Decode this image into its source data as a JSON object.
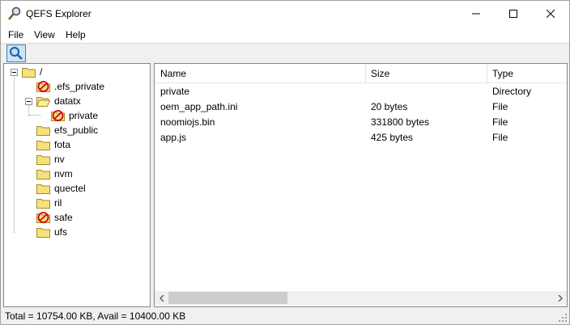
{
  "window": {
    "title": "QEFS Explorer"
  },
  "menu": {
    "file": "File",
    "view": "View",
    "help": "Help"
  },
  "toolbar": {
    "search_icon": "magnifier-icon"
  },
  "tree": {
    "root": "/",
    "items": [
      {
        "label": ".efs_private",
        "restricted": true
      },
      {
        "label": "datatx",
        "expanded": true
      },
      {
        "label": "private",
        "restricted": true
      },
      {
        "label": "efs_public",
        "restricted": false
      },
      {
        "label": "fota",
        "restricted": false
      },
      {
        "label": "nv",
        "restricted": false
      },
      {
        "label": "nvm",
        "restricted": false
      },
      {
        "label": "quectel",
        "restricted": false
      },
      {
        "label": "ril",
        "restricted": false
      },
      {
        "label": "safe",
        "restricted": true
      },
      {
        "label": "ufs",
        "restricted": false
      }
    ]
  },
  "list": {
    "columns": [
      "Name",
      "Size",
      "Type"
    ],
    "rows": [
      {
        "name": "private",
        "size": "",
        "type": "Directory"
      },
      {
        "name": "oem_app_path.ini",
        "size": "20 bytes",
        "type": "File"
      },
      {
        "name": "noomiojs.bin",
        "size": "331800 bytes",
        "type": "File"
      },
      {
        "name": "app.js",
        "size": "425 bytes",
        "type": "File"
      }
    ]
  },
  "status": {
    "text": "Total = 10754.00 KB, Avail = 10400.00 KB"
  },
  "colors": {
    "folder_fill": "#f5e27a",
    "folder_stroke": "#a88b1e",
    "restricted": "#d0021b",
    "selection": "#cce4f7"
  }
}
